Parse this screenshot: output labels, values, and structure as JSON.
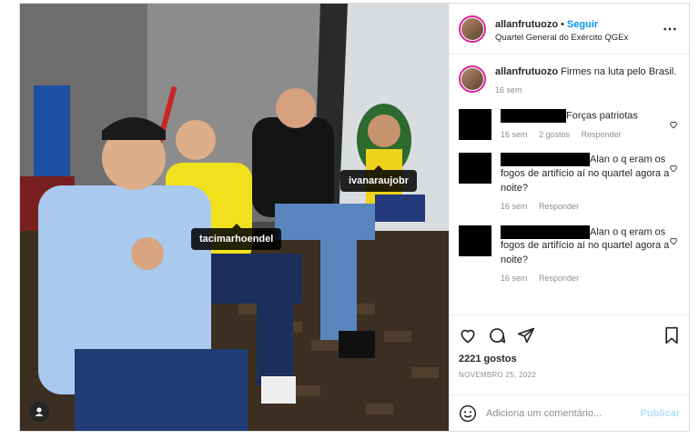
{
  "post": {
    "username": "allanfrutuozo",
    "follow_label": "Seguir",
    "location": "Quartel General do Exército QGEx",
    "photo_tags": [
      "tacimarhoendel",
      "ivanaraujobr"
    ]
  },
  "caption": {
    "username": "allanfrutuozo",
    "text": "Firmes na luta pelo Brasil.",
    "time": "16 sem"
  },
  "comments": [
    {
      "text": "Forças patriotas",
      "time": "16 sem",
      "likes": "2 gostos",
      "reply": "Responder"
    },
    {
      "text": "Alan o q eram os fogos de artifício aí no quartel agora a noite?",
      "time": "16 sem",
      "reply": "Responder"
    },
    {
      "text": "Alan o q eram os fogos de artifício aí no quartel agora a noite?",
      "time": "16 sem",
      "reply": "Responder"
    }
  ],
  "stats": {
    "likes": "2221 gostos",
    "date": "NOVEMBRO 25, 2022"
  },
  "add_comment": {
    "placeholder": "Adiciona um comentário...",
    "publish_label": "Publicar"
  },
  "icons": [
    "heart-icon",
    "comment-icon",
    "share-icon",
    "bookmark-icon",
    "emoji-icon",
    "more-icon",
    "user-icon"
  ]
}
